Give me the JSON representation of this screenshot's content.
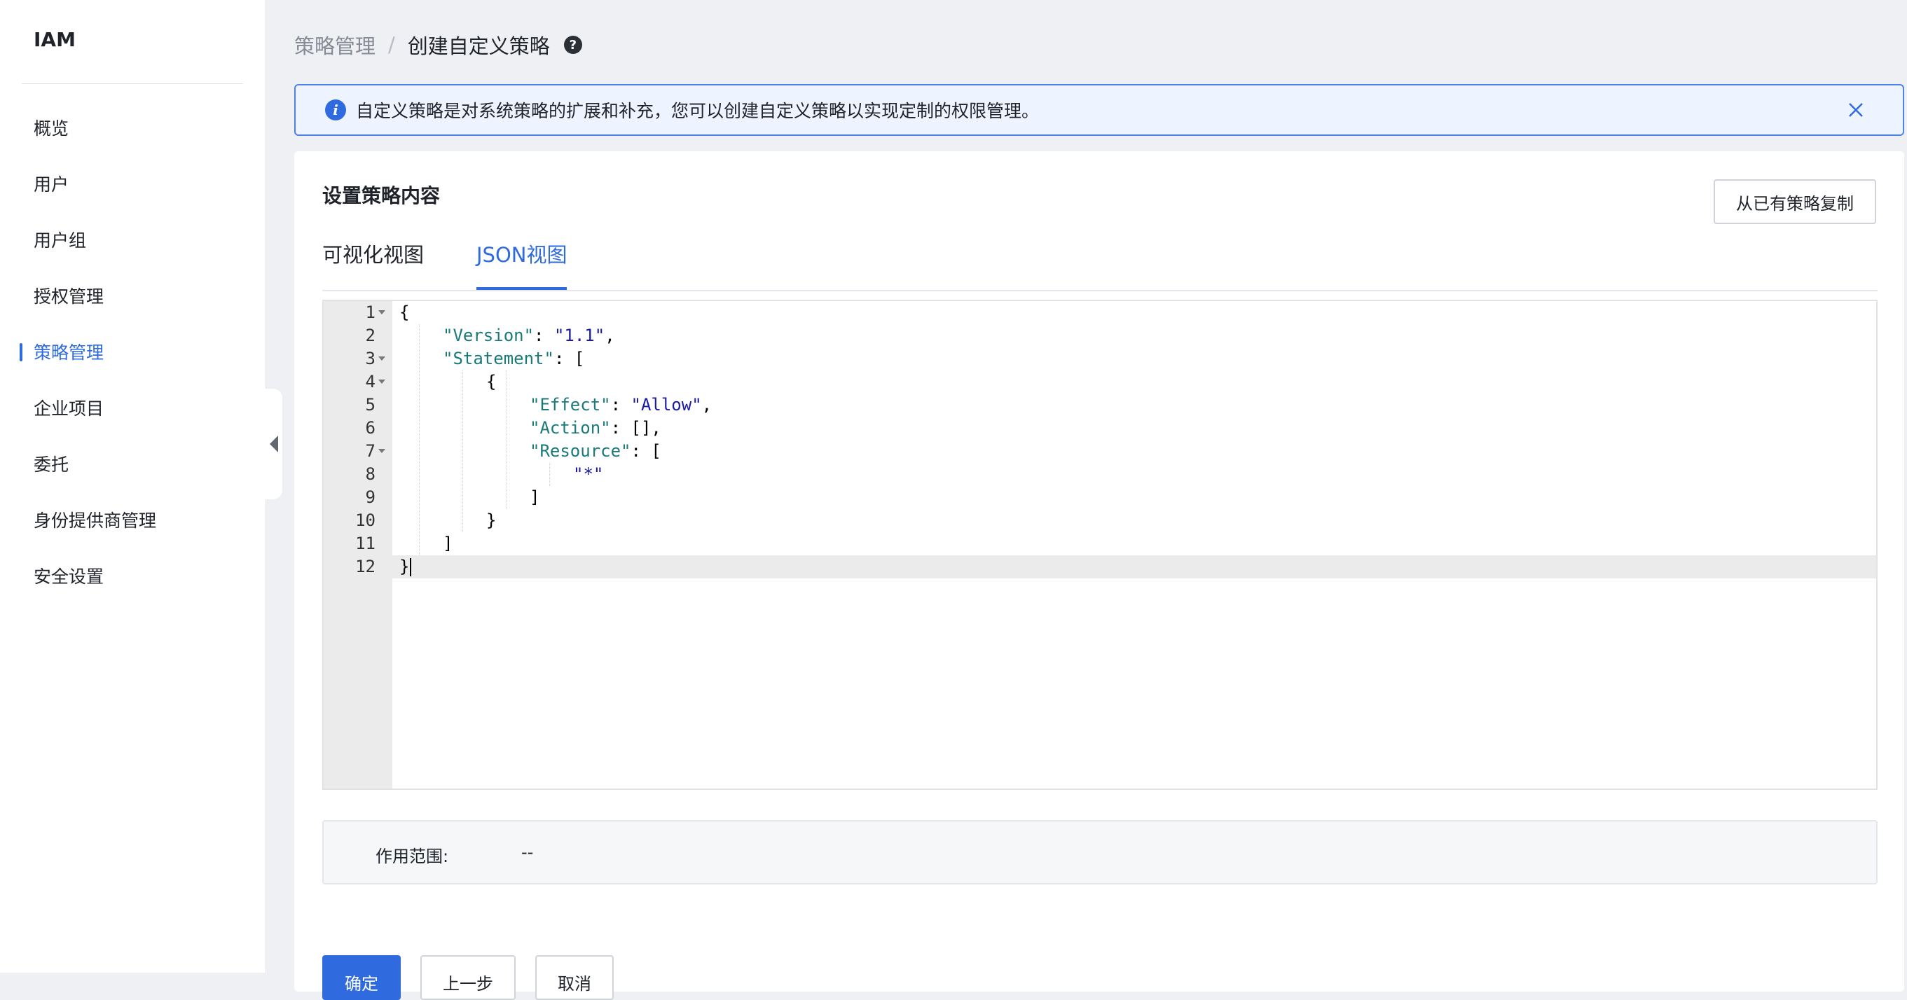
{
  "sidebar": {
    "brand": "IAM",
    "items": [
      {
        "label": "概览"
      },
      {
        "label": "用户"
      },
      {
        "label": "用户组"
      },
      {
        "label": "授权管理"
      },
      {
        "label": "策略管理"
      },
      {
        "label": "企业项目"
      },
      {
        "label": "委托"
      },
      {
        "label": "身份提供商管理"
      },
      {
        "label": "安全设置"
      }
    ],
    "active_index": 4
  },
  "breadcrumb": {
    "parent": "策略管理",
    "separator": "/",
    "current": "创建自定义策略",
    "help_icon": "?"
  },
  "alert": {
    "info_icon": "i",
    "text": "自定义策略是对系统策略的扩展和补充，您可以创建自定义策略以实现定制的权限管理。"
  },
  "card": {
    "title": "设置策略内容",
    "copy_button": "从已有策略复制",
    "tabs": [
      {
        "label": "可视化视图"
      },
      {
        "label": "JSON视图"
      }
    ],
    "active_tab": 1
  },
  "editor": {
    "lines": [
      {
        "n": "1",
        "text": "{"
      },
      {
        "n": "2",
        "text": "\"Version\": \"1.1\","
      },
      {
        "n": "3",
        "text": "\"Statement\": ["
      },
      {
        "n": "4",
        "text": "{"
      },
      {
        "n": "5",
        "text": "\"Effect\": \"Allow\","
      },
      {
        "n": "6",
        "text": "\"Action\": [],"
      },
      {
        "n": "7",
        "text": "\"Resource\": ["
      },
      {
        "n": "8",
        "text": "\"*\""
      },
      {
        "n": "9",
        "text": "]"
      },
      {
        "n": "10",
        "text": "}"
      },
      {
        "n": "11",
        "text": "]"
      },
      {
        "n": "12",
        "text": "}"
      }
    ],
    "current_line": 12
  },
  "scope": {
    "label": "作用范围:",
    "value": "--"
  },
  "footer": {
    "ok": "确定",
    "prev": "上一步",
    "cancel": "取消"
  },
  "colors": {
    "accent": "#2f6bde",
    "json_key": "#1a7a7a",
    "json_string": "#1a1aa6"
  }
}
